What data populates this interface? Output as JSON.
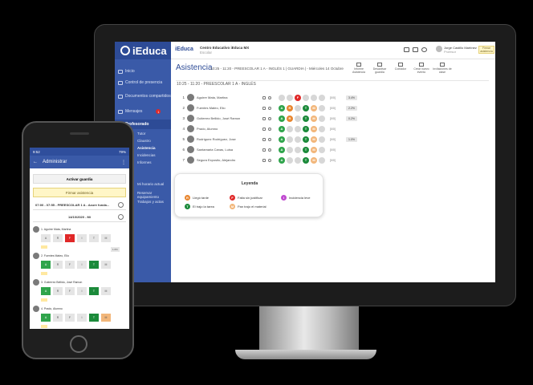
{
  "desktop": {
    "sidebar": {
      "logo": "iEduca",
      "items": [
        {
          "label": "Inicio",
          "icon": "home-icon"
        },
        {
          "label": "Control de presencia",
          "icon": "clock-icon"
        },
        {
          "label": "Documentos compartidos",
          "icon": "folder-icon"
        },
        {
          "label": "Mensajes",
          "icon": "mail-icon",
          "badge": "1"
        },
        {
          "label": "Profesorado",
          "icon": "teacher-icon",
          "selected": true
        }
      ],
      "subitems": [
        "Tutor",
        "Claustro",
        "Asistencia",
        "Incidencias",
        "Informes"
      ],
      "extra": [
        "Mi horario actual",
        "Reservar equipamiento",
        "Trabajos y actas"
      ]
    },
    "topbar": {
      "logo": "iEduca",
      "center": "Centro Educativo iEduca MX",
      "center_sub": "Escolar",
      "user": "Jorge Castillo Martínez",
      "role": "Profesor",
      "button": "Firmar asistencia",
      "mail_badge": "1"
    },
    "header": {
      "title": "Asistencia",
      "subtitle": "10:25 - 11:20 - PREESCOLAR 1 A - INGLÉS 1 | GUARDIA | - Miércoles 14 Octubre",
      "actions": [
        "Informe Asistencia",
        "Desactivar guardia",
        "Contador",
        "Crear nuevo evento",
        "Invitaciones de clase"
      ]
    },
    "filter": "10:25 - 11:20 - PREESCOLAR 1 A - INGLÉS",
    "students": [
      {
        "n": "1",
        "name": "Aguirre Mata, Martina",
        "marks": [
          "",
          "",
          "F",
          "",
          "",
          ""
        ],
        "pct": "[0/0]",
        "badge": "3.4%"
      },
      {
        "n": "2",
        "name": "Fuentes Mateo, Elio",
        "marks": [
          "A",
          "R",
          "",
          "T",
          "M",
          ""
        ],
        "pct": "[0/0]",
        "badge": "2.2%"
      },
      {
        "n": "3",
        "name": "Gutierrez Bellido, José Ramon",
        "marks": [
          "A",
          "R",
          "",
          "T",
          "M",
          ""
        ],
        "pct": "[0/0]",
        "badge": "0.2%"
      },
      {
        "n": "4",
        "name": "Prado, Alumno",
        "marks": [
          "A",
          "",
          "",
          "T",
          "M",
          ""
        ],
        "pct": "[0/0]",
        "badge": ""
      },
      {
        "n": "5",
        "name": "Rodríguez Rodríguez, Jose",
        "marks": [
          "A",
          "",
          "",
          "T",
          "M",
          ""
        ],
        "pct": "[0/0]",
        "badge": "1.0%"
      },
      {
        "n": "6",
        "name": "Santamaria Canas, Luisa",
        "marks": [
          "A",
          "",
          "",
          "T",
          "M",
          ""
        ],
        "pct": "[0/0]",
        "badge": ""
      },
      {
        "n": "7",
        "name": "Segura Exposito, Alejandro",
        "marks": [
          "A",
          "",
          "",
          "T",
          "M",
          ""
        ],
        "pct": "[0/0]",
        "badge": ""
      }
    ],
    "legend": {
      "title": "Leyenda",
      "items": [
        {
          "code": "R",
          "label": "Llegó tarde"
        },
        {
          "code": "F",
          "label": "Falta sin justificar"
        },
        {
          "code": "I",
          "label": "Incidencia leve"
        },
        {
          "code": "T",
          "label": "El trajo la tarea"
        },
        {
          "code": "M",
          "label": "Pan trajo el material"
        }
      ]
    },
    "letters": {
      "A": "A",
      "R": "R",
      "F": "F",
      "T": "T",
      "M": "M",
      "I": "I"
    }
  },
  "phone": {
    "status_time": "9:52",
    "status_right": "79%",
    "title": "Administrar",
    "activate": "Activar guardia",
    "sign": "Firmar asistencia",
    "session": "07:00 - 07:55 - PREESCOLAR 1 A - Azure funda...",
    "date": "14/10/2020 - Mi",
    "students": [
      {
        "name": "1. Aguirre Mata, Martina",
        "btns": [
          "A",
          "R",
          "F",
          "I",
          "T",
          "M"
        ],
        "states": [
          "",
          "",
          "F",
          "",
          "",
          ""
        ],
        "pct": "1.6%"
      },
      {
        "name": "2. Fuentes Mateo, Elio",
        "btns": [
          "A",
          "R",
          "F",
          "I",
          "T",
          "M"
        ],
        "states": [
          "A",
          "",
          "",
          "",
          "T",
          ""
        ],
        "pct": ""
      },
      {
        "name": "3. Gutierrez Bellido, José Ramon",
        "btns": [
          "A",
          "R",
          "F",
          "I",
          "T",
          "M"
        ],
        "states": [
          "A",
          "",
          "",
          "",
          "T",
          ""
        ],
        "pct": ""
      },
      {
        "name": "4. Prado, Alumno",
        "btns": [
          "A",
          "R",
          "F",
          "I",
          "T",
          "M"
        ],
        "states": [
          "A",
          "",
          "",
          "",
          "T",
          "M"
        ],
        "pct": ""
      }
    ]
  }
}
